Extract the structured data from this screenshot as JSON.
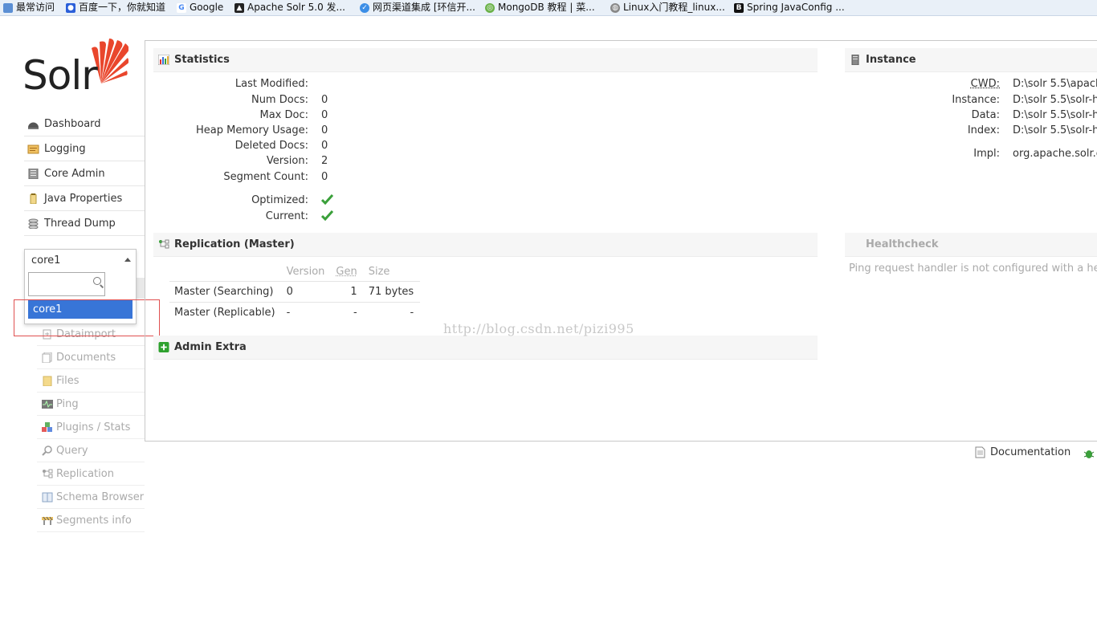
{
  "bookmarks": [
    {
      "label": "最常访问",
      "icon": "folder-icon",
      "color": "#5b8fd4"
    },
    {
      "label": "百度一下，你就知道",
      "icon": "baidu-paw-icon",
      "color": "#2b5fd9"
    },
    {
      "label": "Google",
      "icon": "google-g-icon",
      "color": "#4285f4"
    },
    {
      "label": "Apache Solr 5.0 发...",
      "icon": "penguin-icon",
      "color": "#222222"
    },
    {
      "label": "网页渠道集成 [环信开...",
      "icon": "bird-icon",
      "color": "#3c8ee6"
    },
    {
      "label": "MongoDB 教程 | 菜...",
      "icon": "runoob-icon",
      "color": "#6bb24a"
    },
    {
      "label": "Linux入门教程_linux...",
      "icon": "globe-icon",
      "color": "#888888"
    },
    {
      "label": "Spring JavaConfig ...",
      "icon": "b-logo-icon",
      "color": "#111111"
    }
  ],
  "logo": {
    "text": "Solr",
    "accent": "#e9462c"
  },
  "nav": [
    {
      "label": "Dashboard",
      "icon": "dashboard-icon"
    },
    {
      "label": "Logging",
      "icon": "logging-icon"
    },
    {
      "label": "Core Admin",
      "icon": "core-admin-icon"
    },
    {
      "label": "Java Properties",
      "icon": "java-properties-icon"
    },
    {
      "label": "Thread Dump",
      "icon": "thread-dump-icon"
    }
  ],
  "core_selector": {
    "selected": "core1",
    "search_value": "",
    "options": [
      "core1"
    ]
  },
  "core_menu": [
    {
      "label": "Dataimport",
      "icon": "dataimport-icon"
    },
    {
      "label": "Documents",
      "icon": "documents-icon"
    },
    {
      "label": "Files",
      "icon": "files-icon"
    },
    {
      "label": "Ping",
      "icon": "ping-icon"
    },
    {
      "label": "Plugins / Stats",
      "icon": "plugins-icon"
    },
    {
      "label": "Query",
      "icon": "query-icon"
    },
    {
      "label": "Replication",
      "icon": "replication-icon"
    },
    {
      "label": "Schema Browser",
      "icon": "schema-browser-icon"
    },
    {
      "label": "Segments info",
      "icon": "segments-icon"
    }
  ],
  "statistics": {
    "title": "Statistics",
    "rows": [
      {
        "key": "Last Modified:",
        "value": ""
      },
      {
        "key": "Num Docs:",
        "value": "0"
      },
      {
        "key": "Max Doc:",
        "value": "0"
      },
      {
        "key": "Heap Memory Usage:",
        "value": "0"
      },
      {
        "key": "Deleted Docs:",
        "value": "0"
      },
      {
        "key": "Version:",
        "value": "2"
      },
      {
        "key": "Segment Count:",
        "value": "0"
      }
    ],
    "flags": [
      {
        "key": "Optimized:",
        "value": true
      },
      {
        "key": "Current:",
        "value": true
      }
    ]
  },
  "instance": {
    "title": "Instance",
    "rows": [
      {
        "key": "CWD:",
        "value": "D:\\solr 5.5\\apach"
      },
      {
        "key": "Instance:",
        "value": "D:\\solr 5.5\\solr-h"
      },
      {
        "key": "Data:",
        "value": "D:\\solr 5.5\\solr-h"
      },
      {
        "key": "Index:",
        "value": "D:\\solr 5.5\\solr-h"
      },
      {
        "key": "Impl:",
        "value": "org.apache.solr.c"
      }
    ]
  },
  "replication": {
    "title": "Replication (Master)",
    "columns": [
      "",
      "Version",
      "Gen",
      "Size"
    ],
    "rows": [
      {
        "label": "Master (Searching)",
        "version": "0",
        "gen": "1",
        "size": "71 bytes"
      },
      {
        "label": "Master (Replicable)",
        "version": "-",
        "gen": "-",
        "size": "-"
      }
    ]
  },
  "healthcheck": {
    "title": "Healthcheck",
    "message": "Ping request handler is not configured with a hea"
  },
  "admin_extra": {
    "title": "Admin Extra"
  },
  "watermark": "http://blog.csdn.net/pizi995",
  "footer": {
    "documentation": "Documentation"
  },
  "colors": {
    "check_green": "#3aa03a",
    "selected_option": "#3875d7",
    "highlight_box": "#e05050"
  }
}
